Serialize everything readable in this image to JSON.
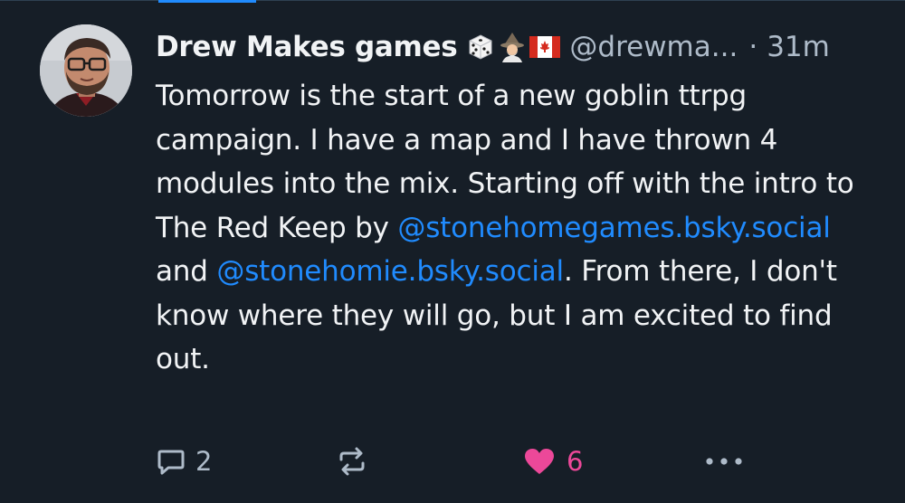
{
  "post": {
    "author": {
      "display_name": "Drew Makes games",
      "handle": "@drewma...",
      "badges": [
        "game-die-emoji",
        "mage-emoji",
        "canada-flag-emoji"
      ]
    },
    "separator": "·",
    "timestamp": "31m",
    "text": {
      "part1": "Tomorrow is the start of a new goblin ttrpg campaign. I have a map and I have thrown 4 modules into the mix. Starting off with the intro to The Red Keep by ",
      "mention1": "@stonehomegames.bsky.social",
      "part2": " and ",
      "mention2": "@stonehomie.bsky.social",
      "part3": ". From there, I don't know where they will go, but I am excited to find out."
    },
    "actions": {
      "reply_count": "2",
      "like_count": "6"
    }
  },
  "colors": {
    "background": "#161e27",
    "text": "#f1f3f5",
    "muted": "#aebbc9",
    "link": "#208bfe",
    "like": "#ec4899"
  }
}
